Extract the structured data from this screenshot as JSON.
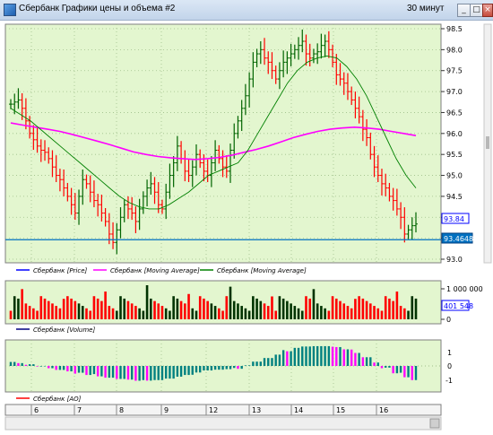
{
  "window": {
    "title": "Сбербанк Графики цены и объема #2",
    "timeframe": "30 минут",
    "minimize_label": "_",
    "maximize_label": "□",
    "close_label": "×"
  },
  "colors": {
    "panel_bg": "#e3f6cf",
    "grid": "#9fbf8a",
    "up_bar": "#006400",
    "down_bar": "#ff0000",
    "ma_slow": "#ff00ff",
    "ma_fast": "#008000",
    "level_line": "#0070c0",
    "volume_up": "#003300",
    "volume_down": "#ff0000",
    "ao_up": "#008080",
    "ao_down": "#ff00ff"
  },
  "price_panel": {
    "y_ticks": [
      "98.5",
      "98.0",
      "97.5",
      "97.0",
      "96.5",
      "96.0",
      "95.5",
      "95.0",
      "94.5",
      "94.0",
      "93.5",
      "93.0"
    ],
    "y_range": [
      93.0,
      98.5
    ],
    "last_price_label": "93.84",
    "level_label": "93.4648",
    "level_value": 93.4648,
    "legend": [
      {
        "label": "Сбербанк [Price]",
        "color": "#0000ff"
      },
      {
        "label": "Сбербанк [Moving Average]",
        "color": "#ff00ff"
      },
      {
        "label": "Сбербанк [Moving Average]",
        "color": "#008000"
      }
    ]
  },
  "volume_panel": {
    "y_ticks": [
      "1 000 000",
      "0"
    ],
    "last_volume_label": "401 548",
    "legend": [
      {
        "label": "Сбербанк [Volume]",
        "color": "#000080"
      }
    ]
  },
  "ao_panel": {
    "y_ticks": [
      "1",
      "0",
      "-1"
    ],
    "legend": [
      {
        "label": "Сбербанк [AO]",
        "color": "#ff0000"
      }
    ]
  },
  "x_axis": {
    "labels": [
      "6",
      "7",
      "8",
      "9",
      "12",
      "13",
      "14",
      "15",
      "16"
    ]
  },
  "chart_data": {
    "type": "line",
    "title": "",
    "x": [
      0,
      3,
      6,
      10,
      14,
      18,
      22,
      26,
      30,
      34,
      38,
      42,
      46,
      50,
      54,
      58,
      62,
      66,
      70,
      74,
      78,
      82,
      86,
      90,
      94,
      98,
      102,
      106,
      110,
      114,
      118,
      122,
      126,
      130,
      134,
      138,
      142,
      146,
      150,
      154,
      158,
      162,
      166,
      170,
      174,
      178,
      182,
      186,
      190,
      194,
      198,
      202,
      206,
      210,
      214,
      218,
      222,
      226,
      230,
      234,
      238,
      242,
      246,
      250,
      254,
      258,
      262,
      266,
      270,
      274,
      278,
      282,
      286,
      290,
      294,
      298,
      302,
      306,
      310,
      314,
      318,
      322,
      326,
      330,
      334,
      338,
      342,
      346,
      350,
      354,
      358,
      362,
      366,
      370,
      374,
      378,
      382,
      386,
      390,
      394,
      398,
      402,
      406,
      410,
      414,
      418,
      422,
      426,
      430,
      434,
      438,
      442,
      446,
      450,
      454,
      458,
      462
    ],
    "series": [
      {
        "name": "Сбербанк [Price]",
        "values": [
          96.7,
          96.75,
          96.8,
          96.6,
          96.3,
          96.0,
          95.85,
          95.7,
          95.6,
          95.55,
          95.4,
          95.2,
          95.0,
          94.9,
          94.7,
          94.5,
          94.3,
          94.1,
          94.5,
          94.9,
          94.8,
          94.6,
          94.4,
          94.3,
          94.1,
          93.9,
          93.6,
          93.4,
          93.7,
          94.0,
          94.3,
          94.2,
          94.1,
          93.9,
          94.2,
          94.5,
          94.7,
          94.8,
          94.6,
          94.3,
          94.2,
          94.6,
          95.0,
          95.3,
          95.7,
          95.4,
          95.1,
          95.0,
          95.2,
          95.5,
          95.3,
          95.1,
          95.0,
          95.3,
          95.6,
          95.4,
          95.2,
          95.1,
          95.6,
          96.0,
          96.3,
          96.6,
          96.9,
          97.3,
          97.7,
          97.9,
          98.0,
          97.8,
          97.7,
          97.5,
          97.3,
          97.5,
          97.7,
          97.8,
          97.9,
          98.0,
          98.1,
          98.2,
          97.9,
          97.8,
          97.9,
          97.95,
          98.1,
          98.2,
          98.0,
          97.7,
          97.4,
          97.3,
          97.2,
          97.0,
          96.8,
          96.6,
          96.4,
          96.1,
          95.9,
          95.5,
          95.2,
          95.0,
          94.8,
          94.7,
          94.5,
          94.4,
          94.2,
          94.0,
          93.6,
          93.7,
          93.8,
          93.84
        ]
      },
      {
        "name": "Сбербанк [Moving Average]",
        "values": [
          96.25,
          96.2,
          96.15,
          96.1,
          96.05,
          95.98,
          95.9,
          95.82,
          95.74,
          95.65,
          95.56,
          95.5,
          95.45,
          95.42,
          95.4,
          95.38,
          95.4,
          95.43,
          95.48,
          95.55,
          95.62,
          95.7,
          95.8,
          95.9,
          95.98,
          96.05,
          96.1,
          96.13,
          96.15,
          96.13,
          96.1,
          96.05,
          96.0,
          95.95
        ]
      },
      {
        "name": "Сбербанк [Moving Average]",
        "values": [
          96.6,
          96.45,
          96.3,
          96.1,
          95.9,
          95.7,
          95.5,
          95.3,
          95.1,
          94.9,
          94.7,
          94.5,
          94.35,
          94.25,
          94.2,
          94.2,
          94.3,
          94.45,
          94.6,
          94.8,
          95.0,
          95.1,
          95.2,
          95.3,
          95.6,
          96.0,
          96.4,
          96.8,
          97.2,
          97.5,
          97.7,
          97.8,
          97.85,
          97.8,
          97.6,
          97.3,
          96.9,
          96.4,
          95.9,
          95.4,
          95.0,
          94.7
        ]
      }
    ],
    "ylim": [
      93.0,
      98.5
    ]
  }
}
